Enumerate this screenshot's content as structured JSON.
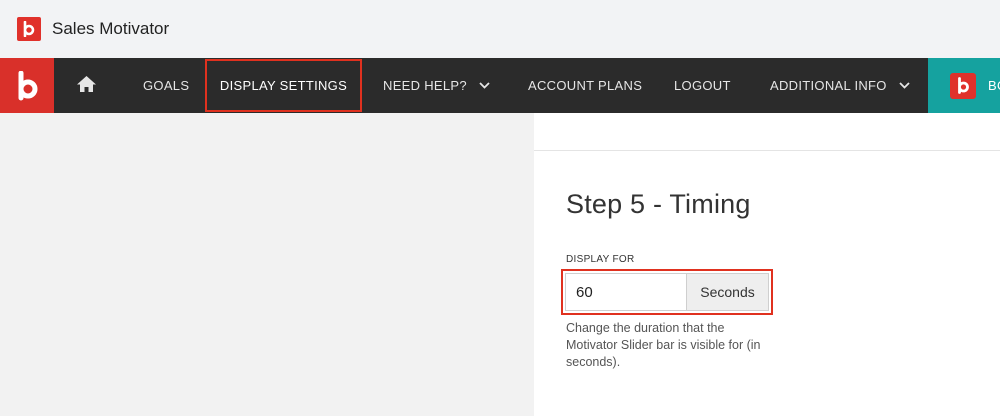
{
  "app": {
    "title": "Sales Motivator"
  },
  "nav": {
    "items": [
      {
        "label": "GOALS"
      },
      {
        "label": "DISPLAY SETTINGS"
      },
      {
        "label": "NEED HELP?"
      },
      {
        "label": "ACCOUNT PLANS"
      },
      {
        "label": "LOGOUT"
      },
      {
        "label": "ADDITIONAL INFO"
      }
    ],
    "teal_text": "BO",
    "icons": {
      "home": "home-icon",
      "brand": "b-logo-icon",
      "dropdown": "chevron-down-icon"
    }
  },
  "main": {
    "step_title": "Step 5 - Timing",
    "display_for": {
      "label": "DISPLAY FOR",
      "value": "60",
      "unit": "Seconds",
      "help": "Change the duration that the Motivator Slider bar is visible for (in seconds)."
    }
  },
  "colors": {
    "brand_red": "#d9302a",
    "nav_bg": "#2b2b2b",
    "teal": "#15a29f",
    "highlight": "#e0311f"
  }
}
